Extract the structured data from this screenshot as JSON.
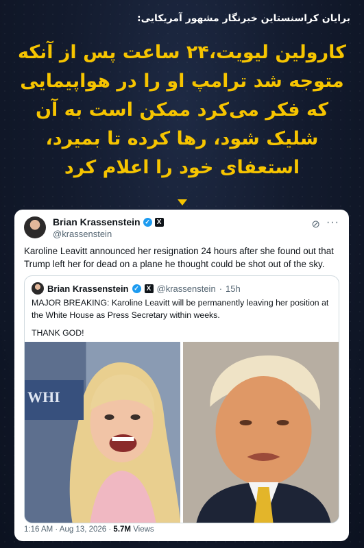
{
  "attribution": "برایان کراسنستاین خبرنگار مشهور آمریکایی:",
  "headline": [
    "کارولین لیویت،۲۴ ساعت پس از آنکه",
    "متوجه شد ترامپ او را در هواپیمایی",
    "که فکر می‌کرد ممکن است به آن",
    "شلیک شود، رها کرده تا بمیرد،",
    "استعفای خود را اعلام کرد"
  ],
  "tweet": {
    "author_name": "Brian Krassenstein",
    "author_handle": "@krassenstein",
    "text": "Karoline Leavitt announced her resignation 24 hours after she found out that Trump left her for dead on a plane he thought could be shot out of the sky.",
    "quoted": {
      "author_name": "Brian Krassenstein",
      "author_handle": "@krassenstein",
      "separator": "·",
      "time": "15h",
      "text": "MAJOR BREAKING:  Karoline Leavitt will be permanently leaving her position at the White House as Press Secretary within weeks.",
      "text2": "THANK GOD!",
      "photo_sign_text": "WHI"
    },
    "footer": {
      "time": "1:16 AM · Aug 13, 2026 · ",
      "views_count": "5.7M",
      "views_label": " Views"
    }
  },
  "icons": {
    "verified": "verified-badge-icon",
    "x_logo": "x-logo-icon",
    "grok": "grok-icon",
    "more": "more-icon",
    "pointer": "down-arrow-icon"
  },
  "colors": {
    "headline": "#f6c400",
    "background": "#131b2e",
    "verified": "#1d9bf0"
  }
}
